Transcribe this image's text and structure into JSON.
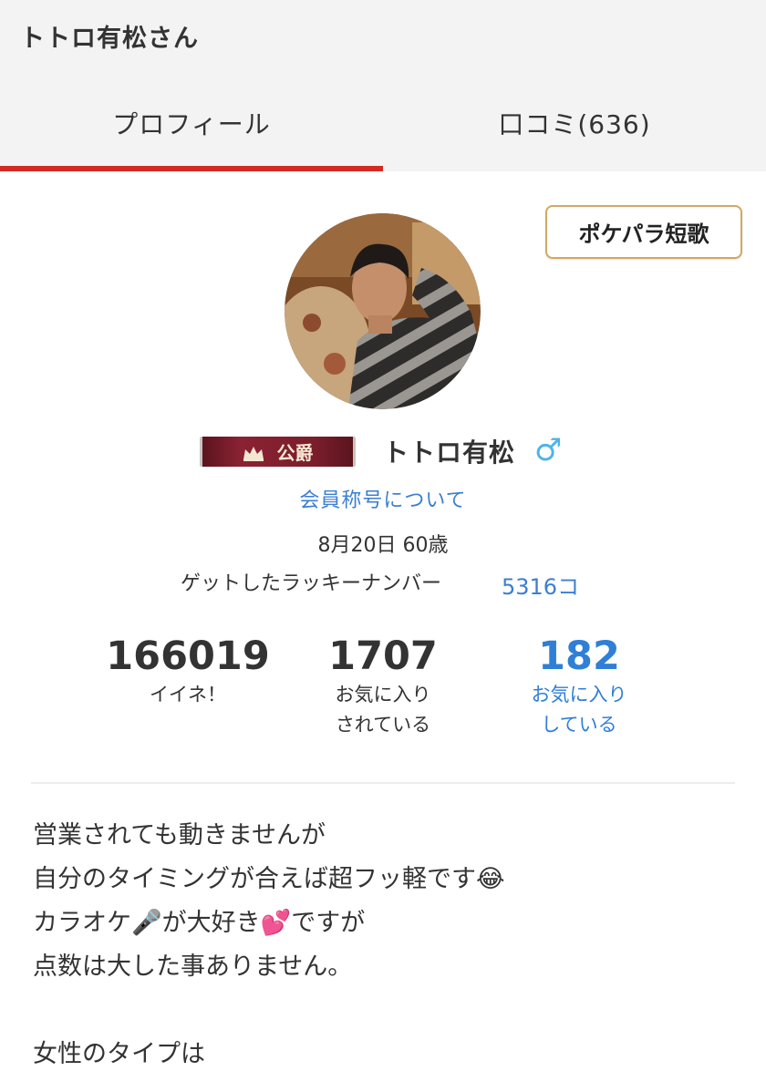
{
  "header": {
    "title": "トトロ有松さん"
  },
  "tabs": [
    {
      "label": "プロフィール",
      "active": true
    },
    {
      "label": "口コミ(636)",
      "active": false
    }
  ],
  "colors": {
    "accent": "#d32a22",
    "link": "#3b7fd1",
    "badge_bg": "#7a1e2c",
    "gold_border": "#d4a860",
    "gender": "#4fb4e6"
  },
  "tanka_button": {
    "label": "ポケパラ短歌"
  },
  "profile": {
    "rank_label": "公爵",
    "name": "トトロ有松",
    "gender_symbol": "♂",
    "title_link": "会員称号について",
    "birthday": "8月20日 60歳",
    "lucky_label": "ゲットしたラッキーナンバー",
    "lucky_value": "5316コ"
  },
  "stats": [
    {
      "value": "166019",
      "label_line1": "イイネ！",
      "label_line2": ""
    },
    {
      "value": "1707",
      "label_line1": "お気に入り",
      "label_line2": "されている"
    },
    {
      "value": "182",
      "label_line1": "お気に入り",
      "label_line2": "している"
    }
  ],
  "bio": {
    "line1": "営業されても動きませんが",
    "line2": "自分のタイミングが合えば超フッ軽です",
    "line2_emoji": "😂",
    "line3a": "カラオケ",
    "line3_emoji1": "🎤",
    "line3b": "が大好き",
    "line3_emoji2": "💕",
    "line3c": "ですが",
    "line4": "点数は大した事ありません。",
    "line6": "女性のタイプは"
  }
}
